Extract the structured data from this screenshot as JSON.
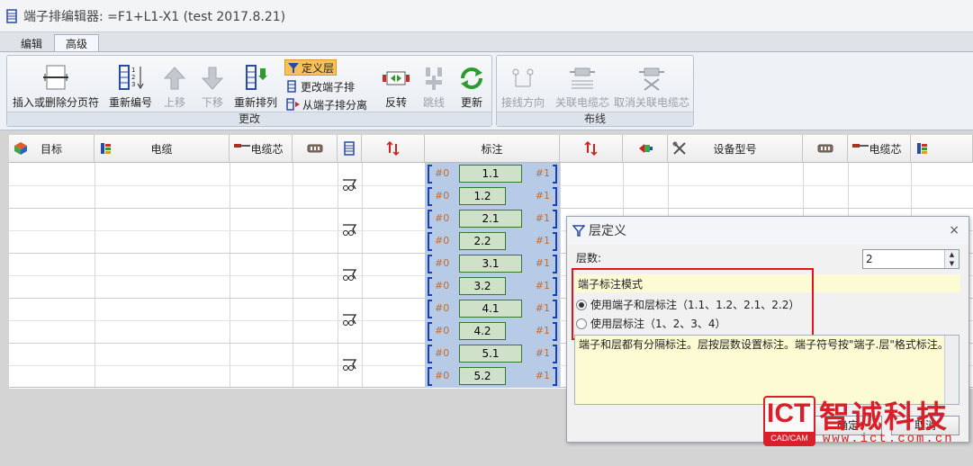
{
  "window": {
    "title": "端子排编辑器: =F1+L1-X1 (test 2017.8.21)"
  },
  "tabs": [
    {
      "label": "编辑"
    },
    {
      "label": "高级"
    }
  ],
  "ribbon": {
    "groups": [
      {
        "label": "更改"
      },
      {
        "label": "布线"
      }
    ],
    "buttons": {
      "insert_delete_page_break": "插入或删除分页符",
      "renumber": "重新编号",
      "move_up": "上移",
      "move_down": "下移",
      "resort": "重新排列",
      "define_layer": "定义层",
      "change_terminal_strip": "更改端子排",
      "detach_from_strip": "从端子排分离",
      "reverse": "反转",
      "jumper": "跳线",
      "refresh": "更新",
      "wiring_direction": "接线方向",
      "link_cable_core": "关联电缆芯",
      "unlink_cable_core": "取消关联电缆芯"
    }
  },
  "grid": {
    "columns": [
      {
        "label": "目标"
      },
      {
        "label": "电缆"
      },
      {
        "label": "电缆芯"
      },
      {
        "label": ""
      },
      {
        "label": ""
      },
      {
        "label": ""
      },
      {
        "label": "标注"
      },
      {
        "label": ""
      },
      {
        "label": ""
      },
      {
        "label": "设备型号"
      },
      {
        "label": ""
      },
      {
        "label": "电缆芯"
      },
      {
        "label": ""
      }
    ],
    "terminals": [
      {
        "left": "#0",
        "label": "1.1",
        "right": "#1"
      },
      {
        "left": "#0",
        "label": "1.2",
        "right": "#1"
      },
      {
        "left": "#0",
        "label": "2.1",
        "right": "#1"
      },
      {
        "left": "#0",
        "label": "2.2",
        "right": "#1"
      },
      {
        "left": "#0",
        "label": "3.1",
        "right": "#1"
      },
      {
        "left": "#0",
        "label": "3.2",
        "right": "#1"
      },
      {
        "left": "#0",
        "label": "4.1",
        "right": "#1"
      },
      {
        "left": "#0",
        "label": "4.2",
        "right": "#1"
      },
      {
        "left": "#0",
        "label": "5.1",
        "right": "#1"
      },
      {
        "left": "#0",
        "label": "5.2",
        "right": "#1"
      }
    ]
  },
  "dialog": {
    "title": "层定义",
    "layers_label": "层数:",
    "layers_value": "2",
    "mode_header": "端子标注模式",
    "option_terminal_and_layer": "使用端子和层标注（1.1、1.2、2.1、2.2）",
    "option_layer_only": "使用层标注（1、2、3、4）",
    "selected_option": "terminal_and_layer",
    "description": "端子和层都有分隔标注。层按层数设置标注。端子符号按\"端子.层\"格式标注。",
    "ok_label": "确定",
    "cancel_label": "取消",
    "close_symbol": "×"
  },
  "watermark": {
    "logo": "ICT",
    "logo_sub": "CAD/CAM",
    "brand": "智诚科技",
    "url": "www.ict.com.cn"
  },
  "colors": {
    "highlight_red": "#e5141c",
    "label_column_bg": "#b8cbe6",
    "terminal_bracket": "#1b3fb5",
    "terminal_box": "#cfe2c9",
    "brand_red": "#d8202a"
  }
}
